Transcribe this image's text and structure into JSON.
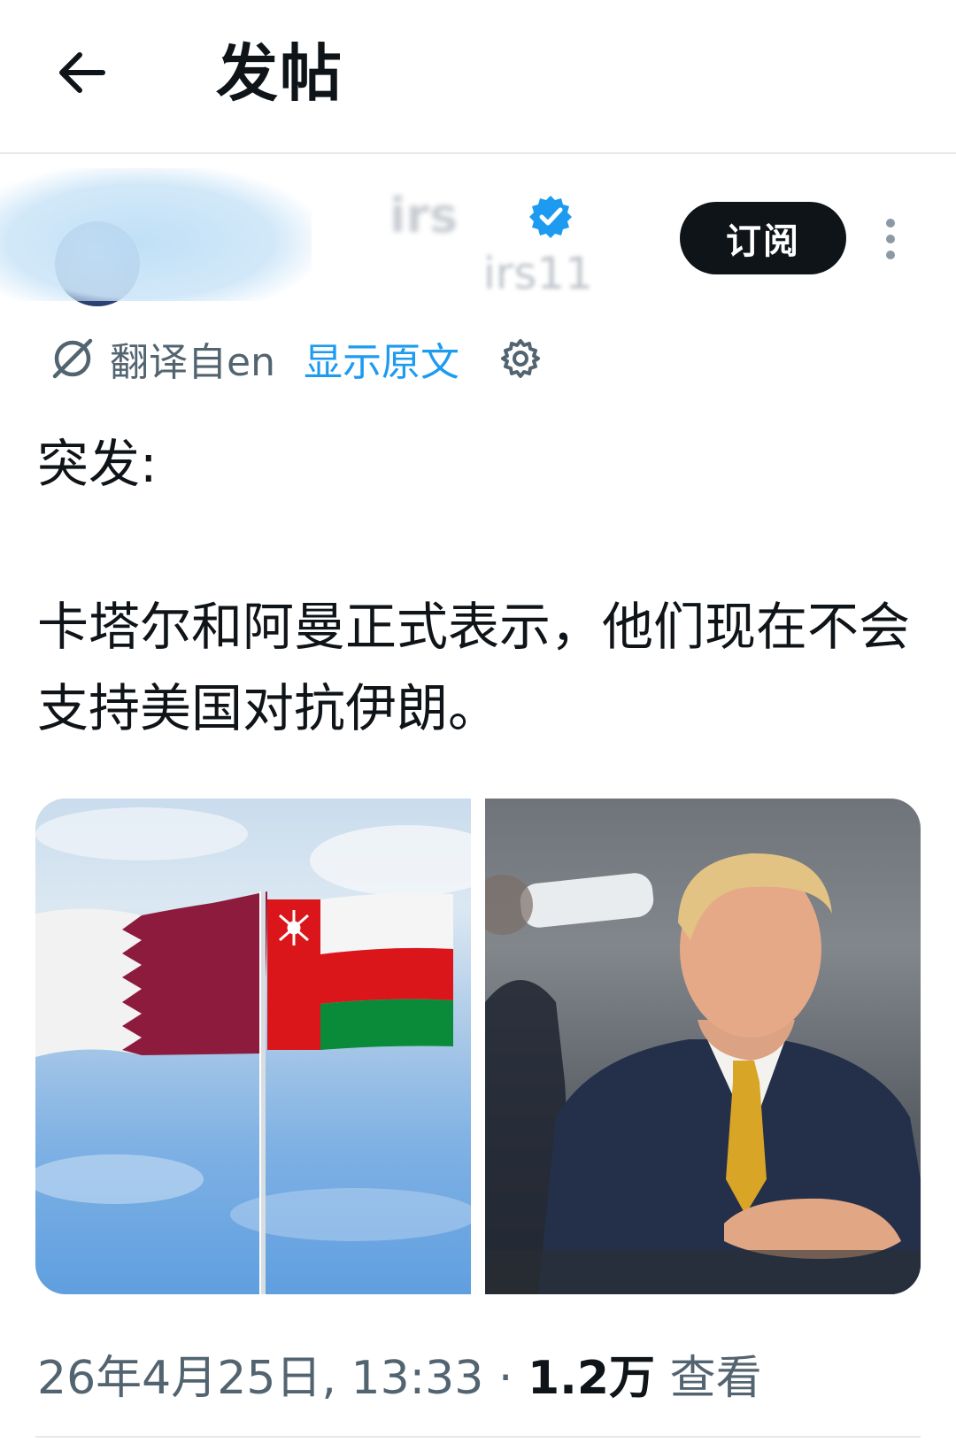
{
  "header": {
    "title": "发帖"
  },
  "author": {
    "display_name_partial": "irs",
    "handle_partial": "irs11",
    "subscribe_label": "订阅"
  },
  "translation": {
    "translated_from": "翻译自en",
    "show_original": "显示原文"
  },
  "post": {
    "text": "突发:\n\n卡塔尔和阿曼正式表示，他们现在不会支持美国对抗伊朗。"
  },
  "meta": {
    "date": "26年4月25日, 13:33",
    "separator": " · ",
    "views_count": "1.2万",
    "views_label": " 查看"
  },
  "colors": {
    "accent": "#1d9bf0",
    "text": "#0f1419",
    "secondary": "#536471",
    "button_bg": "#0f1419",
    "qatar_maroon": "#8d1b3d",
    "oman_red": "#db161b",
    "oman_green": "#008000"
  }
}
